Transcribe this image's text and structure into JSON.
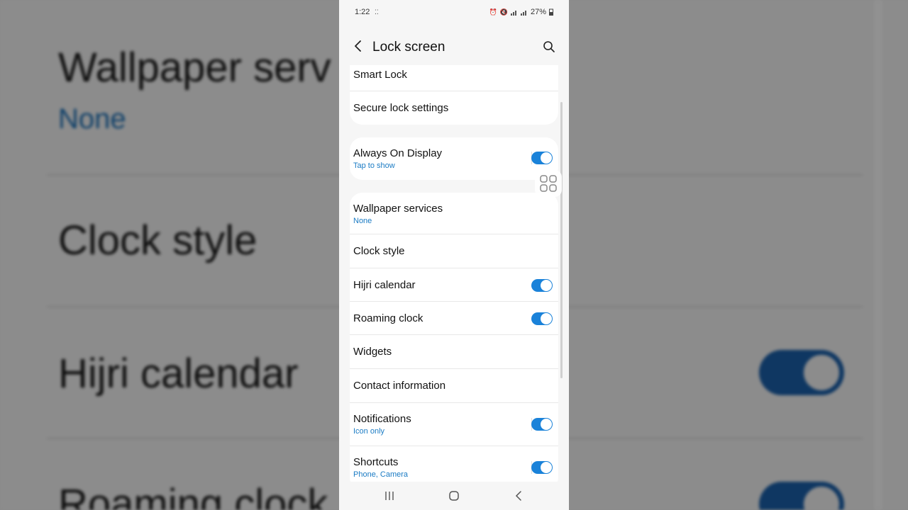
{
  "status_bar": {
    "time": "1:22",
    "battery": "27%",
    "icons": [
      "alarm-icon",
      "mute-icon",
      "signal-icon",
      "signal-icon",
      "battery-icon"
    ]
  },
  "header": {
    "title": "Lock screen"
  },
  "items": {
    "smart_lock": {
      "label": "Smart Lock"
    },
    "secure_lock": {
      "label": "Secure lock settings"
    },
    "aod": {
      "label": "Always On Display",
      "sub": "Tap to show",
      "toggle": true
    },
    "wallpaper": {
      "label": "Wallpaper services",
      "sub": "None"
    },
    "clock_style": {
      "label": "Clock style"
    },
    "hijri": {
      "label": "Hijri calendar",
      "toggle": true
    },
    "roaming": {
      "label": "Roaming clock",
      "toggle": true
    },
    "widgets": {
      "label": "Widgets"
    },
    "contact": {
      "label": "Contact information"
    },
    "notifications": {
      "label": "Notifications",
      "sub": "Icon only",
      "toggle": true
    },
    "shortcuts": {
      "label": "Shortcuts",
      "sub": "Phone, Camera",
      "toggle": true
    }
  },
  "background": {
    "wallpaper_label": "Wallpaper serv",
    "wallpaper_sub": "None",
    "clock_label": "Clock style",
    "hijri_label": "Hijri calendar",
    "roaming_label": "Roaming clock"
  },
  "colors": {
    "accent": "#1a82d9",
    "subtext": "#1a7bc4",
    "card": "#ffffff",
    "screen_bg": "#f6f6f6"
  }
}
